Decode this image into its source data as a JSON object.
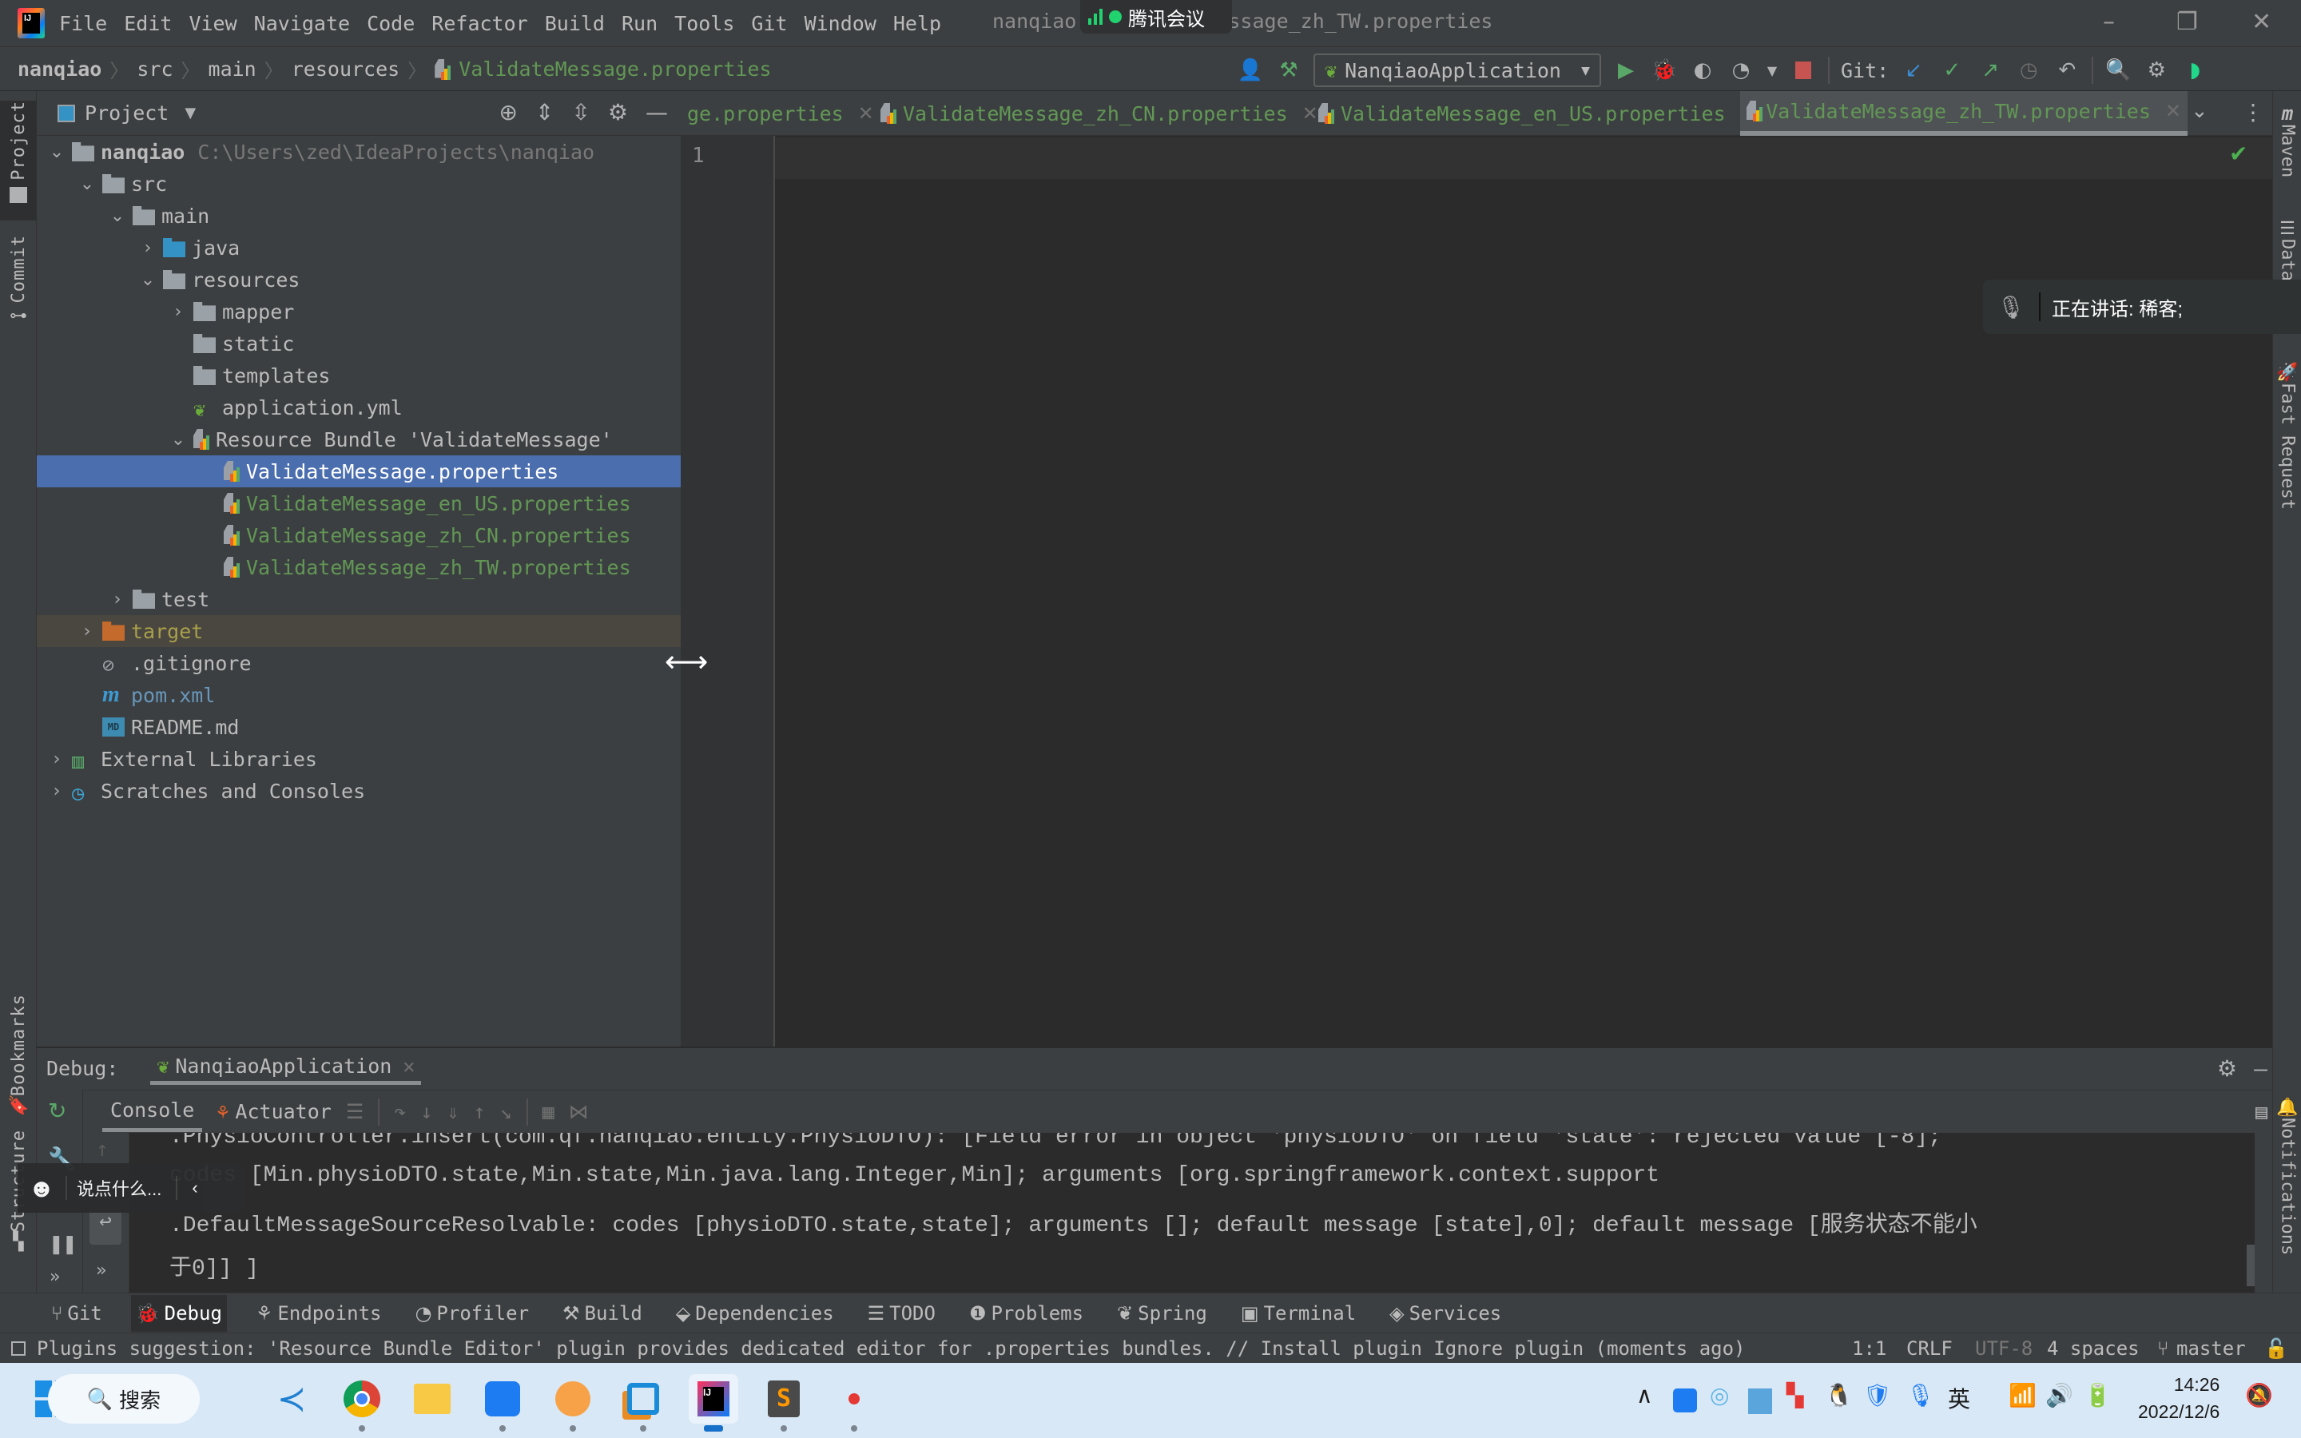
{
  "app": {
    "menu": [
      "File",
      "Edit",
      "View",
      "Navigate",
      "Code",
      "Refactor",
      "Build",
      "Run",
      "Tools",
      "Git",
      "Window",
      "Help"
    ],
    "window_title": "nanqiao - ValidateMessage_zh_TW.properties",
    "window_title_visible_left": "nanqiao",
    "window_title_visible_right": "ssage_zh_TW.properties",
    "window_controls": {
      "minimize": "–",
      "restore": "❐",
      "close": "✕"
    }
  },
  "meeting_overlay": {
    "label": "腾讯会议"
  },
  "breadcrumb": [
    "nanqiao",
    "src",
    "main",
    "resources",
    "ValidateMessage.properties"
  ],
  "toolbar": {
    "run_config": "NanqiaoApplication",
    "git_label": "Git:"
  },
  "left_stripe": {
    "project": "Project",
    "commit": "Commit",
    "bookmarks": "Bookmarks",
    "structure": "Structure"
  },
  "right_stripe": {
    "maven": "Maven",
    "database": "Database",
    "fast_request": "Fast Request",
    "notifications": "Notifications"
  },
  "project_panel": {
    "title": "Project",
    "tree": [
      {
        "label": "nanqiao",
        "extra": "C:\\Users\\zed\\IdeaProjects\\nanqiao",
        "level": 0,
        "expanded": true,
        "icon": "module-folder"
      },
      {
        "label": "src",
        "level": 1,
        "expanded": true,
        "icon": "folder"
      },
      {
        "label": "main",
        "level": 2,
        "expanded": true,
        "icon": "folder"
      },
      {
        "label": "java",
        "level": 3,
        "expanded": false,
        "icon": "source-folder"
      },
      {
        "label": "resources",
        "level": 3,
        "expanded": true,
        "icon": "resources-folder"
      },
      {
        "label": "mapper",
        "level": 4,
        "expanded": false,
        "icon": "folder"
      },
      {
        "label": "static",
        "level": 4,
        "icon": "folder"
      },
      {
        "label": "templates",
        "level": 4,
        "icon": "folder"
      },
      {
        "label": "application.yml",
        "level": 4,
        "icon": "spring-yml"
      },
      {
        "label": "Resource Bundle 'ValidateMessage'",
        "level": 4,
        "expanded": true,
        "icon": "resource-bundle"
      },
      {
        "label": "ValidateMessage.properties",
        "level": 5,
        "icon": "properties",
        "selected": true
      },
      {
        "label": "ValidateMessage_en_US.properties",
        "level": 5,
        "icon": "properties"
      },
      {
        "label": "ValidateMessage_zh_CN.properties",
        "level": 5,
        "icon": "properties"
      },
      {
        "label": "ValidateMessage_zh_TW.properties",
        "level": 5,
        "icon": "properties"
      },
      {
        "label": "test",
        "level": 2,
        "expanded": false,
        "icon": "folder"
      },
      {
        "label": "target",
        "level": 1,
        "expanded": false,
        "icon": "excluded-folder"
      },
      {
        "label": ".gitignore",
        "level": 1,
        "icon": "ignore-file"
      },
      {
        "label": "pom.xml",
        "level": 1,
        "icon": "maven"
      },
      {
        "label": "README.md",
        "level": 1,
        "icon": "markdown"
      },
      {
        "label": "External Libraries",
        "level": 0,
        "expanded": false,
        "icon": "libraries"
      },
      {
        "label": "Scratches and Consoles",
        "level": 0,
        "expanded": false,
        "icon": "scratches"
      }
    ]
  },
  "editor": {
    "tabs": [
      {
        "label": "ValidateMessage.properties",
        "visible_label": "ge.properties",
        "active": false
      },
      {
        "label": "ValidateMessage_zh_CN.properties",
        "active": false
      },
      {
        "label": "ValidateMessage_en_US.properties",
        "active": false
      },
      {
        "label": "ValidateMessage_zh_TW.properties",
        "active": true
      }
    ],
    "line_numbers": [
      "1"
    ]
  },
  "voice_toast": {
    "text": "正在讲话: 稀客;"
  },
  "debug": {
    "label": "Debug:",
    "session": "NanqiaoApplication",
    "tabs": [
      "Console",
      "Actuator"
    ],
    "console_lines": [
      ".PhysioController.insert(com.qf.nanqiao.entity.PhysioDTO): [Field error in object 'physioDTO' on field 'state': rejected value [-8];",
      "codes [Min.physioDTO.state,Min.state,Min.java.lang.Integer,Min]; arguments [org.springframework.context.support",
      ".DefaultMessageSourceResolvable: codes [physioDTO.state,state]; arguments []; default message [state],0]; default message [服务状态不能小",
      "于0]] ]"
    ]
  },
  "chat_bar": {
    "placeholder": "说点什么..."
  },
  "tool_windows": [
    "Git",
    "Debug",
    "Endpoints",
    "Profiler",
    "Build",
    "Dependencies",
    "TODO",
    "Problems",
    "Spring",
    "Terminal",
    "Services"
  ],
  "tool_windows_active": "Debug",
  "status_bar": {
    "message": "Plugins suggestion: 'Resource Bundle Editor' plugin provides dedicated editor for .properties bundles. // Install plugin   Ignore plugin (moments ago)",
    "position": "1:1",
    "line_sep": "CRLF",
    "encoding": "UTF-8",
    "indent": "4 spaces",
    "branch": "master"
  },
  "taskbar": {
    "search_label": "搜索",
    "ime": "英",
    "time": "14:26",
    "date": "2022/12/6"
  },
  "colors": {
    "accent_selection": "#4b6eaf",
    "properties_green": "#629755",
    "bg_dark": "#2b2b2b",
    "bg_panel": "#3c3f41"
  }
}
